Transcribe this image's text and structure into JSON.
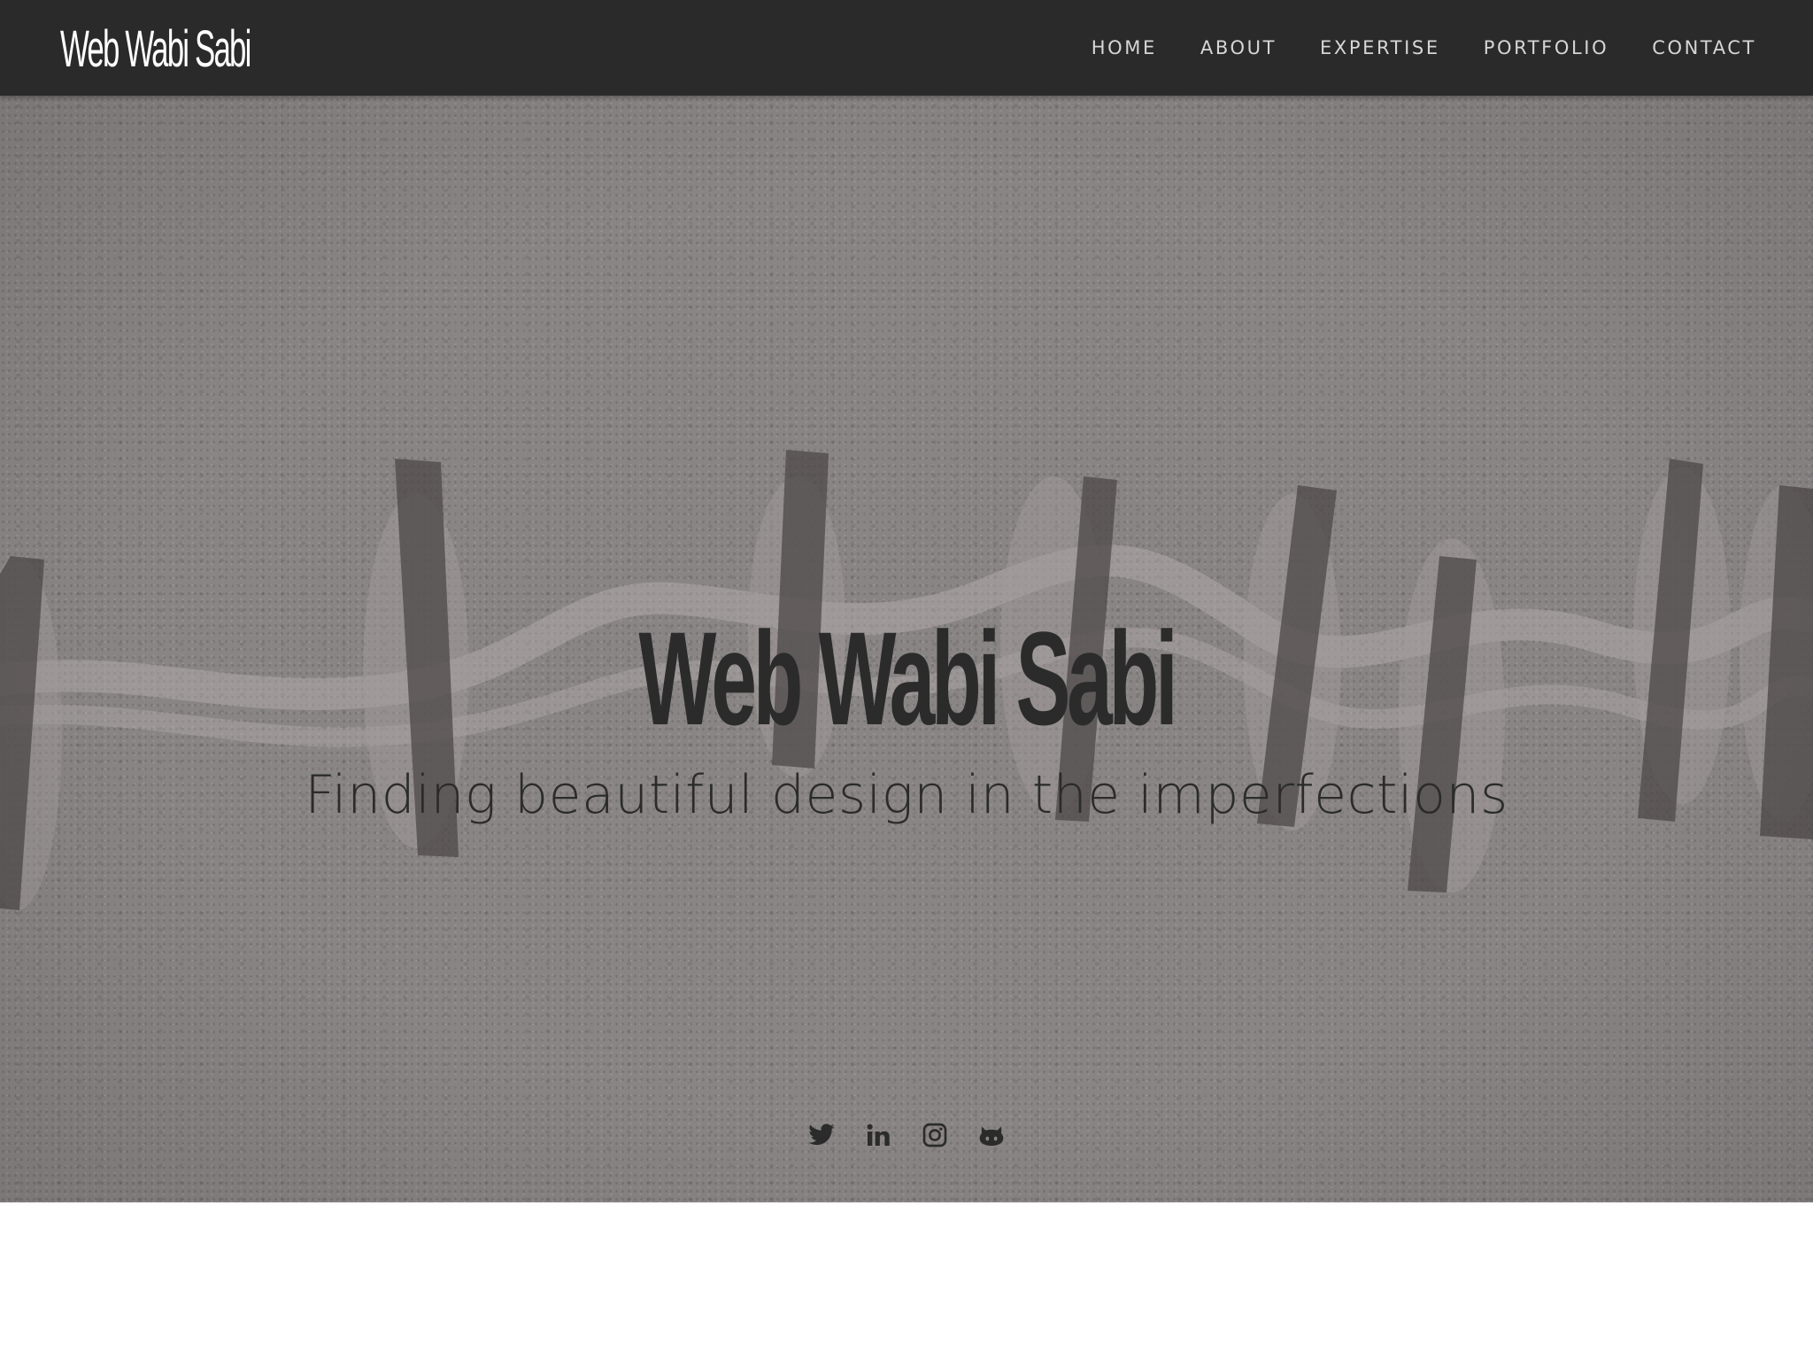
{
  "navbar": {
    "brand": "Web Wabi Sabi",
    "items": [
      {
        "label": "HOME"
      },
      {
        "label": "ABOUT"
      },
      {
        "label": "EXPERTISE"
      },
      {
        "label": "PORTFOLIO"
      },
      {
        "label": "CONTACT"
      }
    ]
  },
  "hero": {
    "title": "Web Wabi Sabi",
    "subtitle": "Finding beautiful design in the imperfections"
  },
  "social": {
    "icons": [
      "twitter-icon",
      "linkedin-icon",
      "instagram-icon",
      "github-icon"
    ]
  },
  "colors": {
    "navbar_bg": "#2a2a2a",
    "nav_text": "#d6d6d6",
    "hero_bg": "#8a8585",
    "hero_text": "#2b2b2b",
    "page_bg": "#ffffff"
  }
}
